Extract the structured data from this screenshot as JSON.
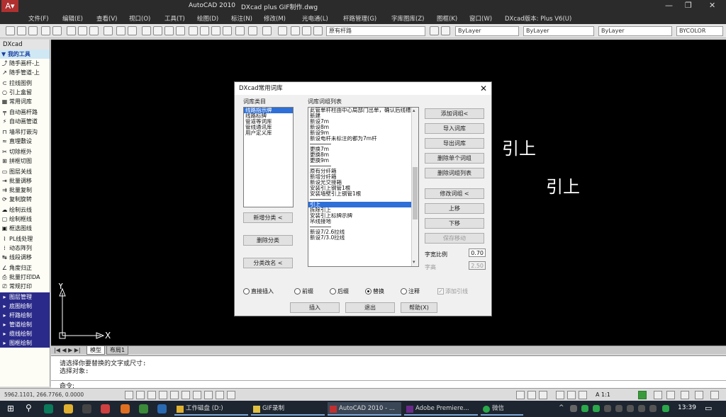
{
  "window": {
    "app_title": "AutoCAD 2010",
    "doc_title": "DXcad plus GIF制作.dwg",
    "min": "—",
    "max": "❐",
    "close": "✕"
  },
  "menu": [
    "文件(F)",
    "编辑(E)",
    "查看(V)",
    "视口(O)",
    "工具(T)",
    "绘图(D)",
    "标注(N)",
    "修改(M)",
    "光电通(L)",
    "杆路管理(G)",
    "字库图库(Z)",
    "图框(K)",
    "窗口(W)",
    "DXcad版本: Plus V6(U)"
  ],
  "toolbar": {
    "layer_combo": "原有杆路",
    "color_combo": "ByLayer",
    "linetype_combo": "ByLayer",
    "lineweight_combo": "ByLayer",
    "plotstyle_combo": "BYCOLOR"
  },
  "left_panel": {
    "header": "DXcad",
    "section_title": "我的工具",
    "groups": [
      [
        "随手画杆-上",
        "随手管道-上"
      ],
      [
        "拉线图例",
        "引上盒留",
        "常用词库"
      ],
      [
        "自动画杆路",
        "自动画管道"
      ],
      [
        "墙吊打嵌沟",
        "直埋敷设"
      ],
      [
        "切除框外",
        "拼框切图"
      ],
      [
        "图层关线",
        "批量调移",
        "批量复制",
        "复制旋转"
      ],
      [
        "绘制云线",
        "绘制框线",
        "框选图线"
      ],
      [
        "PL线处理",
        "动态阵列",
        "线段调移"
      ],
      [
        "角度归正",
        "批量打印DA",
        "常规打印"
      ]
    ],
    "sections": [
      "图层管理",
      "底图绘制",
      "杆路绘制",
      "管道绘制",
      "缆线绘制",
      "图框绘制"
    ]
  },
  "canvas": {
    "labels": [
      "引上",
      "引上"
    ],
    "ucs": {
      "x": "X",
      "y": "Y"
    }
  },
  "layout_tabs": {
    "nav": "|◀ ◀ ▶ ▶|",
    "model": "模型",
    "layout": "布局1"
  },
  "command": {
    "history": [
      "请选择你要替换的文字或尺寸:",
      "选择对象:"
    ],
    "prompt": "命令:"
  },
  "status": {
    "coords": "5962.1101, 266.7766, 0.0000",
    "annotation_scale": "A 1:1"
  },
  "dialog": {
    "title": "DXcad常用词库",
    "close": "✕",
    "category_label": "词库类目",
    "categories": [
      "线路指示牌",
      "线路标牌",
      "管道等词库",
      "管线通讯库",
      "用户定义库"
    ],
    "selected_category": 0,
    "phrase_label": "词库词组列表",
    "phrase_list": [
      {
        "t": "此管单杆柱由中心局部门出单，确认后线槽",
        "s": false
      },
      {
        "t": "新建",
        "s": false
      },
      {
        "t": "新设7m",
        "s": false
      },
      {
        "t": "新设8m",
        "s": false
      },
      {
        "t": "新设9m",
        "s": false
      },
      {
        "t": "新设电杆未标注的都为7m杆",
        "s": false
      },
      {
        "t": "",
        "s": false
      },
      {
        "t": "更换7m",
        "s": false
      },
      {
        "t": "更换8m",
        "s": false
      },
      {
        "t": "更换9m",
        "s": false
      },
      {
        "t": "",
        "s": false
      },
      {
        "t": "原有分纤箱",
        "s": false
      },
      {
        "t": "新增分纤箱",
        "s": false
      },
      {
        "t": "新设光交接箱",
        "s": false
      },
      {
        "t": "安装引上钢管1根",
        "s": false
      },
      {
        "t": "安装墙壁引上钢管1根",
        "s": false
      },
      {
        "t": "",
        "s": false
      },
      {
        "t": "引上",
        "s": true
      },
      {
        "t": "拆除引上",
        "s": false
      },
      {
        "t": "安装引上标牌示牌",
        "s": false
      },
      {
        "t": "吊线接地",
        "s": false
      },
      {
        "t": "",
        "s": false
      },
      {
        "t": "新设7/2.6拉线",
        "s": false
      },
      {
        "t": "新设7/3.0拉线",
        "s": false
      }
    ],
    "buttons_left": [
      "新增分类 <",
      "删除分类",
      "分类改名 <"
    ],
    "buttons_right": [
      "添加词组<",
      "导入词库",
      "导出词库",
      "删除单个词组",
      "删除词组列表",
      "修改词组 <",
      "上移",
      "下移",
      "保存移动"
    ],
    "scale_label": "字宽比例",
    "scale_value": "0.70",
    "height_label": "字高",
    "height_value": "2.50",
    "modes": [
      "直接插入",
      "前缀",
      "后缀",
      "替换",
      "注释"
    ],
    "selected_mode": 3,
    "add_leader": "添加引线",
    "bottom_buttons": [
      "插入",
      "退出",
      "帮助(X)"
    ]
  },
  "taskbar": {
    "apps": [
      {
        "label": "工作磁盘 (D:)",
        "state": "open"
      },
      {
        "label": "GIF录制",
        "state": "open"
      },
      {
        "label": "AutoCAD 2010 - ...",
        "state": "active"
      },
      {
        "label": "Adobe Premiere...",
        "state": "open"
      },
      {
        "label": "微信",
        "state": "open"
      }
    ],
    "clock": "13:39"
  }
}
